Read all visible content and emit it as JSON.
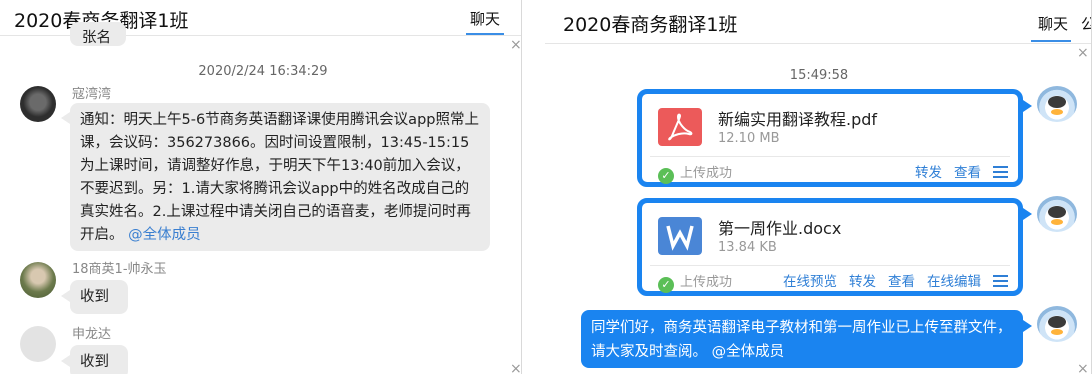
{
  "left": {
    "title": "2020春商务翻译1班",
    "tab": "聊天",
    "truncated_bubble": "张名",
    "timestamp": "2020/2/24 16:34:29",
    "messages": [
      {
        "sender": "寇湾湾",
        "text": "通知：明天上午5-6节商务英语翻译课使用腾讯会议app照常上课，会议码：356273866。因时间设置限制，13:45-15:15为上课时间，请调整好作息，于明天下午13:40前加入会议，不要迟到。另：1.请大家将腾讯会议app中的姓名改成自己的真实姓名。2.上课过程中请关闭自己的语音麦，老师提问时再开启。",
        "mention": "@全体成员"
      },
      {
        "sender": "18商英1-帅永玉",
        "text": "收到"
      },
      {
        "sender": "申龙达",
        "text": "收到"
      }
    ]
  },
  "right": {
    "title": "2020春商务翻译1班",
    "tab": "聊天",
    "tab2": "公",
    "timestamp": "15:49:58",
    "files": [
      {
        "name": "新编实用翻译教程.pdf",
        "size": "12.10 MB",
        "status": "上传成功",
        "actions": [
          "转发",
          "查看"
        ],
        "icon": "pdf-icon"
      },
      {
        "name": "第一周作业.docx",
        "size": "13.84 KB",
        "status": "上传成功",
        "actions": [
          "在线预览",
          "转发",
          "查看",
          "在线编辑"
        ],
        "icon": "word-icon"
      }
    ],
    "message": {
      "text": "同学们好，商务英语翻译电子教材和第一周作业已上传至群文件，请大家及时查阅。",
      "mention": "@全体成员"
    }
  },
  "colors": {
    "accent": "#1a84f0",
    "pdf": "#ec5a5a",
    "word": "#4a86d6",
    "success": "#5bbf57"
  }
}
